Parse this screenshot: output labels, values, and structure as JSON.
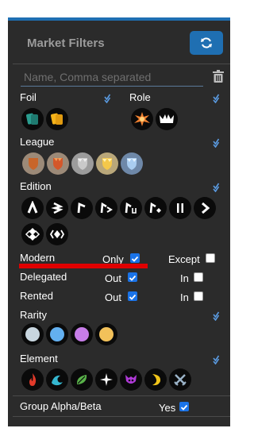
{
  "header": {
    "title": "Market Filters"
  },
  "search": {
    "placeholder": "Name, Comma separated"
  },
  "sections": {
    "foil": "Foil",
    "role": "Role",
    "league": "League",
    "edition": "Edition",
    "rarity": "Rarity",
    "element": "Element"
  },
  "options": {
    "modern": "Modern",
    "only": "Only",
    "except": "Except",
    "delegated": "Delegated",
    "out": "Out",
    "in": "In",
    "rented": "Rented",
    "group_alpha_beta": "Group Alpha/Beta",
    "yes": "Yes"
  },
  "checkbox_states": {
    "modern_only": true,
    "modern_except": false,
    "delegated_out": true,
    "delegated_in": false,
    "rented_out": true,
    "rented_in": false,
    "group_alpha_beta_yes": true
  },
  "edition_glyphs": [
    "ᴧ",
    "⊰",
    "ℸ",
    "ℵ",
    "⋈",
    "◈",
    "Ⅱ",
    "›",
    "◈",
    "⟨◈⟩"
  ],
  "colors": {
    "panel": "#2b2b2b",
    "accent": "#1f6fb2",
    "highlight": "#e00000",
    "rarity_common": "#c8d6df",
    "rarity_rare": "#63b0f0",
    "rarity_epic": "#c77de8",
    "rarity_legendary": "#f2c15a"
  }
}
